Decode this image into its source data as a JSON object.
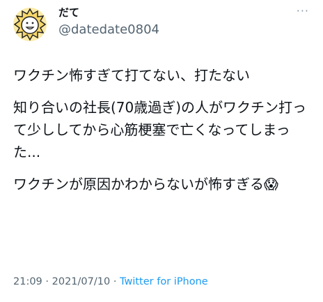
{
  "author": {
    "display_name": "だて",
    "handle": "@datedate0804",
    "avatar_icon": "lion-sun-avatar-icon"
  },
  "more_icon": "···",
  "tweet": {
    "paragraphs": [
      "ワクチン怖すぎて打てない、打たない",
      "知り合いの社長(70歳過ぎ)の人がワクチン打って少ししてから心筋梗塞で亡くなってしまった...",
      "ワクチンが原因かわからないが怖すぎる😱"
    ]
  },
  "meta": {
    "time": "21:09",
    "separator": "·",
    "date": "2021/07/10",
    "source": "Twitter for iPhone"
  },
  "colors": {
    "text": "#0f1419",
    "muted": "#536471",
    "link": "#1d9bf0"
  }
}
